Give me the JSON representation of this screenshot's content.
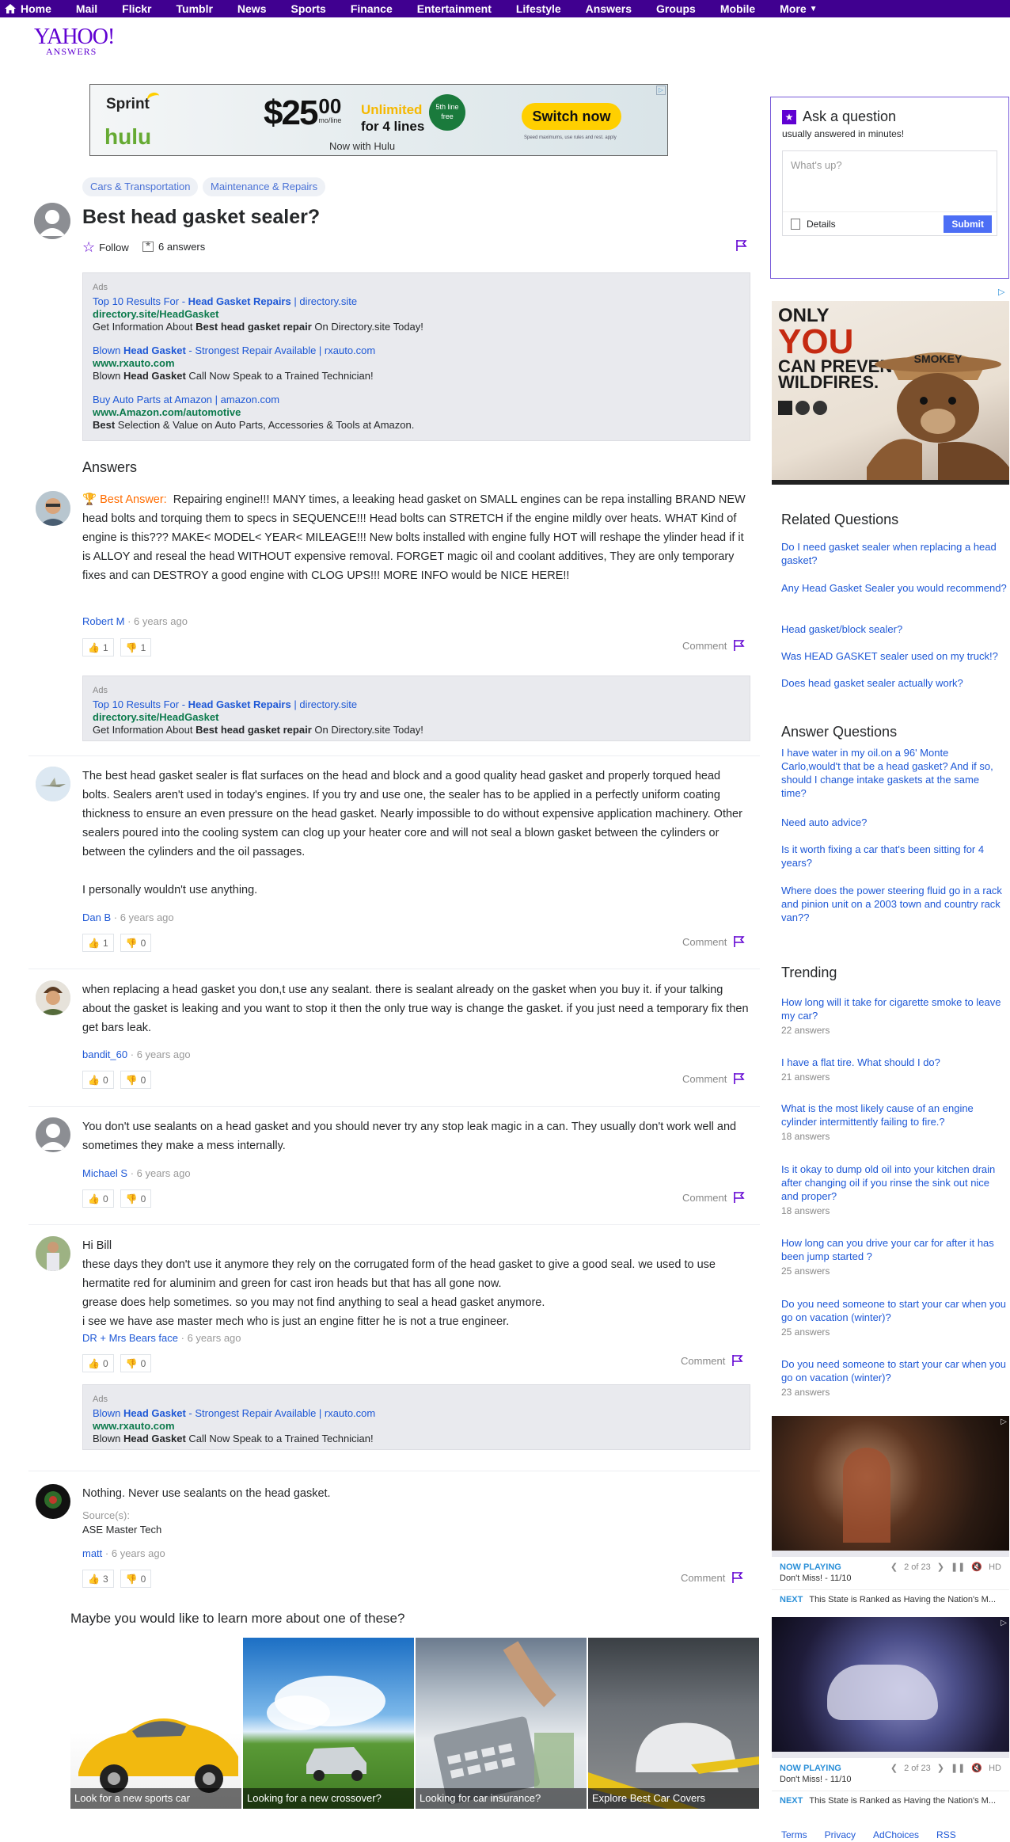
{
  "nav": [
    "Home",
    "Mail",
    "Flickr",
    "Tumblr",
    "News",
    "Sports",
    "Finance",
    "Entertainment",
    "Lifestyle",
    "Answers",
    "Groups",
    "Mobile",
    "More"
  ],
  "logo": {
    "main": "YAHOO!",
    "sub": "ANSWERS"
  },
  "top_ad": {
    "brand1": "Sprint",
    "brand2": "hulu",
    "price_big": "$25",
    "price_cents": "00",
    "price_unit": "mo/line",
    "unlimited": "Unlimited",
    "for_lines": "for 4 lines",
    "free": "5th line free",
    "with": "Now with Hulu",
    "cta": "Switch now",
    "fine": "Speed maximums, use rules and rest. apply"
  },
  "categories": [
    "Cars & Transportation",
    "Maintenance & Repairs"
  ],
  "question": {
    "title": "Best head gasket sealer?",
    "follow": "Follow",
    "answers_count": "6 answers"
  },
  "ads1": {
    "label": "Ads",
    "items": [
      {
        "t1": "Top 10 Results For - ",
        "tb": "Head Gasket Repairs",
        "t2": " | directory.site",
        "url": "directory.site/HeadGasket",
        "d1": "Get Information About ",
        "db": "Best head gasket repair",
        "d2": " On Directory.site Today!"
      },
      {
        "t1": "Blown ",
        "tb": "Head Gasket",
        "t2": " - Strongest Repair Available | rxauto.com",
        "url": "www.rxauto.com",
        "d1": "Blown ",
        "db": "Head Gasket",
        "d2": " Call Now Speak to a Trained Technician!"
      },
      {
        "t1": "Buy Auto Parts at Amazon | amazon.com",
        "tb": "",
        "t2": "",
        "url": "www.Amazon.com/automotive",
        "d1": "",
        "db": "Best",
        "d2": " Selection & Value on Auto Parts, Accessories & Tools at Amazon."
      }
    ]
  },
  "answers_heading": "Answers",
  "best_label": "Best Answer:",
  "answers": [
    {
      "text": "Repairing engine!!! MANY times, a leeaking head gasket on SMALL engines can be repa installing BRAND NEW head bolts and torquing them to specs in SEQUENCE!!! Head bolts can STRETCH if the engine mildly over heats. WHAT Kind of engine is this??? MAKE< MODEL< YEAR< MILEAGE!!! New bolts installed with engine fully HOT will reshape the ylinder head if it is ALLOY and reseal the head WITHOUT expensive removal. FORGET magic oil and coolant additives, They are only temporary fixes and can DESTROY a good engine with CLOG UPS!!! MORE INFO would be NICE HERE!!",
      "author": "Robert M",
      "age": "6 years ago",
      "up": "1",
      "down": "1",
      "comment": "Comment"
    },
    {
      "text": "The best head gasket sealer is flat surfaces on the head and block and a good quality head gasket and properly torqued head bolts. Sealers aren't used in today's engines. If you try and use one, the sealer has to be applied in a perfectly uniform coating thickness to ensure an even pressure on the head gasket. Nearly impossible to do without expensive application machinery. Other sealers poured into the cooling system can clog up your heater core and will not seal a blown gasket between the cylinders or between the cylinders and the oil passages.",
      "text2": "I personally wouldn't use anything.",
      "author": "Dan B",
      "age": "6 years ago",
      "up": "1",
      "down": "0",
      "comment": "Comment"
    },
    {
      "text": "when replacing a head gasket you don,t use any sealant. there is sealant already on the gasket when you buy it. if your talking about the gasket is leaking and you want to stop it then the only true way is change the gasket. if you just need a temporary fix then get bars leak.",
      "author": "bandit_60",
      "age": "6 years ago",
      "up": "0",
      "down": "0",
      "comment": "Comment"
    },
    {
      "text": "You don't use sealants on a head gasket and you should never try any stop leak magic in a can. They usually don't work well and sometimes they make a mess internally.",
      "author": "Michael S",
      "age": "6 years ago",
      "up": "0",
      "down": "0",
      "comment": "Comment"
    },
    {
      "l1": "Hi Bill",
      "l2": "these days they don't use it anymore they rely on the corrugated form of the head gasket to give a good seal. we used to use hermatite red for aluminim and green for cast iron heads but that has all gone now.",
      "l3": "grease does help sometimes. so you may not find anything to seal a head gasket anymore.",
      "l4": "i see we have ase master mech who is just an engine fitter he is not a true engineer.",
      "author": "DR + Mrs Bears face",
      "age": "6 years ago",
      "up": "0",
      "down": "0",
      "comment": "Comment"
    },
    {
      "text": "Nothing. Never use sealants on the head gasket.",
      "source_label": "Source(s):",
      "source": "ASE Master Tech",
      "author": "matt",
      "age": "6 years ago",
      "up": "3",
      "down": "0",
      "comment": "Comment"
    }
  ],
  "ads2": {
    "label": "Ads",
    "t1": "Top 10 Results For - ",
    "tb": "Head Gasket Repairs",
    "t2": " | directory.site",
    "url": "directory.site/HeadGasket",
    "d1": "Get Information About ",
    "db": "Best head gasket repair",
    "d2": " On Directory.site Today!"
  },
  "ads3": {
    "label": "Ads",
    "t1": "Blown ",
    "tb": "Head Gasket",
    "t2": " - Strongest Repair Available | rxauto.com",
    "url": "www.rxauto.com",
    "d1": "Blown ",
    "db": "Head Gasket",
    "d2": " Call Now Speak to a Trained Technician!"
  },
  "learn": {
    "heading": "Maybe you would like to learn more about one of these?",
    "tiles": [
      "Look for a new sports car",
      "Looking for a new crossover?",
      "Looking for car insurance?",
      "Explore Best Car Covers"
    ]
  },
  "ask": {
    "title": "Ask a question",
    "sub": "usually answered in minutes!",
    "placeholder": "What's up?",
    "details": "Details",
    "submit": "Submit"
  },
  "smokey": {
    "l1": "ONLY",
    "l2": "YOU",
    "l3": "CAN PREVENT",
    "l4": "WILDFIRES.",
    "hat": "SMOKEY"
  },
  "related": {
    "heading": "Related Questions",
    "items": [
      "Do I need gasket sealer when replacing a head gasket?",
      "Any Head Gasket Sealer you would recommend?",
      "Head gasket/block sealer?",
      "Was HEAD GASKET sealer used on my truck!?",
      "Does head gasket sealer actually work?"
    ]
  },
  "answerq": {
    "heading": "Answer Questions",
    "items": [
      "I have water in my oil.on a 96' Monte Carlo,would't that be a head gasket? And if so, should I change intake gaskets at the same time?",
      "Need auto advice?",
      "Is it worth fixing a car that's been sitting for 4 years?",
      "Where does the power steering fluid go in a rack and pinion unit on a 2003 town and country rack van??"
    ]
  },
  "trending": {
    "heading": "Trending",
    "items": [
      {
        "q": "How long will it take for cigarette smoke to leave my car?",
        "c": "22 answers"
      },
      {
        "q": "I have a flat tire. What should I do?",
        "c": "21 answers"
      },
      {
        "q": "What is the most likely cause of an engine cylinder intermittently failing to fire.?",
        "c": "18 answers"
      },
      {
        "q": "Is it okay to dump old oil into your kitchen drain after changing oil if you rinse the sink out nice and proper?",
        "c": "18 answers"
      },
      {
        "q": "How long can you drive your car for after it has been jump started ?",
        "c": "25 answers"
      },
      {
        "q": "Do you need someone to start your car when you go on vacation (winter)?",
        "c": "25 answers"
      },
      {
        "q": "Do you need someone to start your car when you go on vacation (winter)?",
        "c": "23 answers"
      }
    ]
  },
  "videos": [
    {
      "playing": "NOW PLAYING",
      "count": "2 of 23",
      "hd": "HD",
      "sub": "Don't Miss! - 11/10",
      "next": "NEXT",
      "next_text": "This State is Ranked as Having the Nation's M..."
    },
    {
      "playing": "NOW PLAYING",
      "count": "2 of 23",
      "hd": "HD",
      "sub": "Don't Miss! - 11/10",
      "next": "NEXT",
      "next_text": "This State is Ranked as Having the Nation's M..."
    }
  ],
  "footer": [
    "Terms",
    "Privacy",
    "AdChoices",
    "RSS"
  ]
}
